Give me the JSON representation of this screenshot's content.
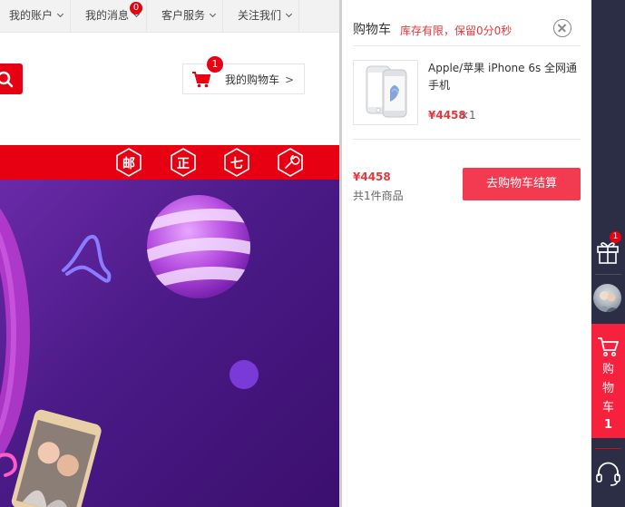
{
  "topnav": {
    "account": "我的账户",
    "messages": "我的消息",
    "messages_badge": "0",
    "service": "客户服务",
    "follow": "关注我们"
  },
  "header": {
    "cart_button": "我的购物车",
    "cart_arrow": ">",
    "cart_badge": "1"
  },
  "promo_bar": {
    "badges": [
      "邮",
      "正",
      "七",
      "wrench-icon"
    ],
    "color": "#e60012"
  },
  "cart_drawer": {
    "title": "购物车",
    "notice": "库存有限，保留0分0秒",
    "items": [
      {
        "name": "Apple/苹果 iPhone 6s 全网通手机",
        "price": "¥4458",
        "qty": "×1",
        "image": "iphone-6s-silver"
      }
    ],
    "total_price": "¥4458",
    "total_count": "共1件商品",
    "checkout_label": "去购物车结算",
    "accent": "#f23a50"
  },
  "sidebar": {
    "gift_badge": "1",
    "cart_label": "购物车",
    "cart_count": "1",
    "cart_color": "#f5213d",
    "bg_color": "#2b2e44"
  }
}
